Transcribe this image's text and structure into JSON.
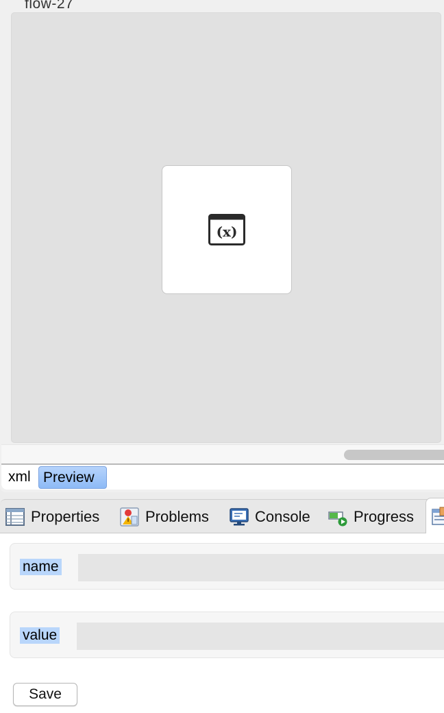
{
  "editor": {
    "title": "flow-27",
    "node_icon": "variable-x-icon",
    "tabs": [
      {
        "label": "xml",
        "active": false
      },
      {
        "label": "Preview",
        "active": true
      }
    ]
  },
  "views": {
    "tabs": [
      {
        "label": "Properties",
        "icon": "properties-table-icon"
      },
      {
        "label": "Problems",
        "icon": "problems-icon"
      },
      {
        "label": "Console",
        "icon": "console-monitor-icon"
      },
      {
        "label": "Progress",
        "icon": "progress-icon"
      }
    ],
    "active_icon": "properties-form-icon"
  },
  "form": {
    "name_label": "name",
    "name_value": "",
    "value_label": "value",
    "value_value": "",
    "save_label": "Save"
  },
  "colors": {
    "selection": "#b9d6fb",
    "tab_active": "#9fc6f8",
    "canvas": "#e1e1e1"
  }
}
